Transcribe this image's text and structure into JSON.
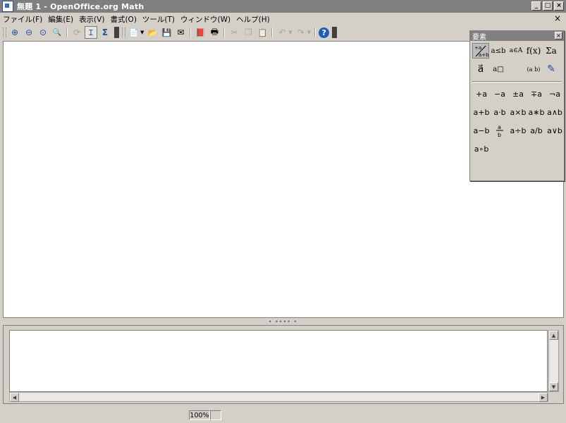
{
  "window": {
    "title": "無題 1 - OpenOffice.org Math",
    "minimize": "_",
    "maximize": "□",
    "close": "×"
  },
  "menubar": {
    "items": [
      {
        "label": "ファイル(F)"
      },
      {
        "label": "編集(E)"
      },
      {
        "label": "表示(V)"
      },
      {
        "label": "書式(O)"
      },
      {
        "label": "ツール(T)"
      },
      {
        "label": "ウィンドウ(W)"
      },
      {
        "label": "ヘルプ(H)"
      }
    ],
    "doc_close": "×"
  },
  "toolbar": {
    "glyphs": {
      "zoom_in": "⊕",
      "zoom_out": "⊖",
      "zoom_100": "⊙",
      "zoom_fit": "🔍",
      "update": "⟳",
      "formula_cursor": "Ｉ",
      "symbols": "Σ",
      "new": "📄",
      "open": "📂",
      "save": "💾",
      "email": "✉",
      "pdf": "📕",
      "print": "🖶",
      "cut": "✂",
      "copy": "❐",
      "paste": "📋",
      "undo": "↶",
      "redo": "↷",
      "help": "?"
    }
  },
  "elements_panel": {
    "title": "要素",
    "close": "×",
    "categories": [
      {
        "label": "+a/a+b",
        "selected": true
      },
      {
        "label": "a≤b"
      },
      {
        "label": "a∈A"
      },
      {
        "label": "f(x)"
      },
      {
        "label": "Σa"
      },
      {
        "label": "a⃗"
      },
      {
        "label": "a□"
      },
      {
        "label": ""
      },
      {
        "label": "(a b)"
      },
      {
        "label": "✎"
      }
    ],
    "elements": [
      "+a",
      "−a",
      "±a",
      "∓a",
      "¬a",
      "a+b",
      "a·b",
      "a×b",
      "a∗b",
      "a∧b",
      "a−b",
      "a/b frac",
      "a÷b",
      "a/b",
      "a∨b",
      "a∘b"
    ]
  },
  "splitter": {
    "dots": "• •••• •"
  },
  "statusbar": {
    "zoom": "100%"
  }
}
